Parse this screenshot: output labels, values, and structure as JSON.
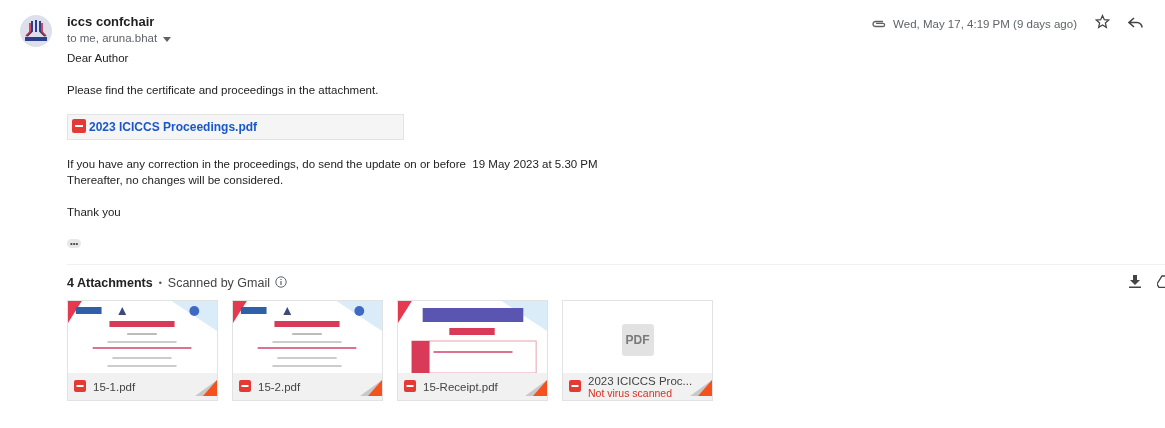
{
  "sender": {
    "name": "iccs confchair",
    "recipients": "to me, aruna.bhat",
    "date": "Wed, May 17, 4:19 PM (9 days ago)",
    "has_attachment": true,
    "starred": false
  },
  "body": {
    "greeting": "Dear Author",
    "intro": "Please find the certificate and proceedings in the attachment.",
    "inline_attachment": "2023 ICICCS Proceedings.pdf",
    "lines": [
      "If you have any correction in the proceedings, do send the update on or before  19 May 2023 at 5.30 PM",
      "Thereafter, no changes will be considered."
    ],
    "closing": "Thank you",
    "trimmed": "•••"
  },
  "attachments_header": {
    "count": "4 Attachments",
    "separator": "•",
    "scan_note": "Scanned by Gmail"
  },
  "attachments": [
    {
      "name": "15-1.pdf",
      "preview": {
        "kind": "certificate"
      }
    },
    {
      "name": "15-2.pdf",
      "preview": {
        "kind": "certificate"
      }
    },
    {
      "name": "15-Receipt.pdf",
      "preview": {
        "kind": "receipt"
      }
    },
    {
      "name": "2023 ICICCS Proc...",
      "warning": "Not virus scanned",
      "preview": {
        "kind": "placeholder",
        "label": "PDF"
      }
    }
  ]
}
